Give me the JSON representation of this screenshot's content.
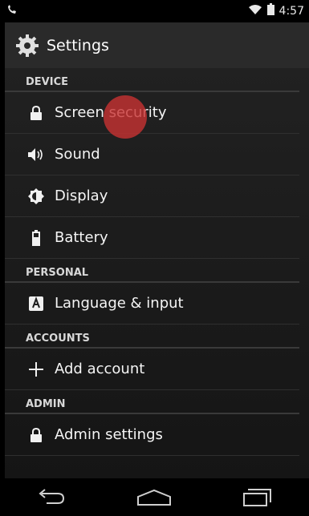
{
  "status": {
    "time": "4:57"
  },
  "header": {
    "title": "Settings"
  },
  "sections": [
    {
      "title": "DEVICE",
      "items": [
        {
          "label": "Screen security",
          "icon": "lock-icon"
        },
        {
          "label": "Sound",
          "icon": "speaker-icon"
        },
        {
          "label": "Display",
          "icon": "brightness-icon"
        },
        {
          "label": "Battery",
          "icon": "battery-icon"
        }
      ]
    },
    {
      "title": "PERSONAL",
      "items": [
        {
          "label": "Language & input",
          "icon": "keyboard-a-icon"
        }
      ]
    },
    {
      "title": "ACCOUNTS",
      "items": [
        {
          "label": "Add account",
          "icon": "plus-icon"
        }
      ]
    },
    {
      "title": "ADMIN",
      "items": [
        {
          "label": "Admin settings",
          "icon": "lock-icon"
        }
      ]
    }
  ],
  "colors": {
    "touch_indicator": "#c83232",
    "actionbar": "#2a2a2a",
    "background": "#1b1b1b"
  }
}
